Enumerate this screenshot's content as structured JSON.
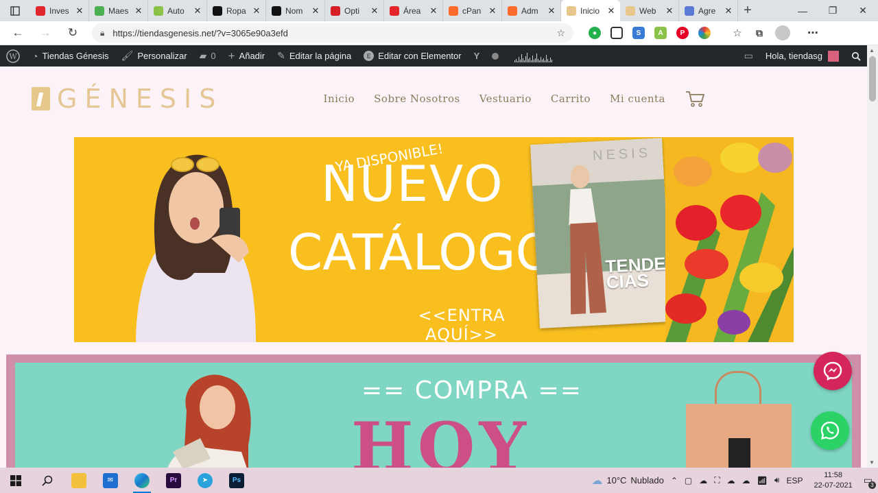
{
  "browser": {
    "tabs": [
      {
        "title": "Inves",
        "icon": "video-play-icon",
        "color": "#e1262c"
      },
      {
        "title": "Maes",
        "icon": "sheet-icon",
        "color": "#4caf50"
      },
      {
        "title": "Auto",
        "icon": "android-icon",
        "color": "#8bc34a"
      },
      {
        "title": "Ropa",
        "icon": "shopify-s-icon",
        "color": "#111111"
      },
      {
        "title": "Nom",
        "icon": "shopify-s-icon",
        "color": "#111111"
      },
      {
        "title": "Opti",
        "icon": "opti-icon",
        "color": "#d81f26"
      },
      {
        "title": "Área",
        "icon": "w-icon",
        "color": "#e5252a"
      },
      {
        "title": "cPan",
        "icon": "cpanel-icon",
        "color": "#ff6c2c"
      },
      {
        "title": "Adm",
        "icon": "cpanel-icon",
        "color": "#ff6c2c"
      },
      {
        "title": "Inicio",
        "icon": "site-favicon-icon",
        "color": "#e8c78c"
      },
      {
        "title": "Web",
        "icon": "site-favicon-icon",
        "color": "#e8c78c"
      },
      {
        "title": "Agre",
        "icon": "page-icon",
        "color": "#5b7bd5"
      }
    ],
    "url": "https://tiendasgenesis.net/?v=3065e90a3efd"
  },
  "adminbar": {
    "site_name": "Tiendas Génesis",
    "customize": "Personalizar",
    "comments_count": "0",
    "add_new": "Añadir",
    "edit_page": "Editar la página",
    "edit_elementor": "Editar con Elementor",
    "greeting": "Hola, tiendasg"
  },
  "site": {
    "logo_text": "GÉNESIS",
    "menu": [
      "Inicio",
      "Sobre Nosotros",
      "Vestuario",
      "Carrito",
      "Mi cuenta"
    ]
  },
  "banner1": {
    "small_text": "YA DISPONIBLE!",
    "title_line1": "NUEVO",
    "title_line2": "CATÁLOGO!!",
    "cta": "<<ENTRA AQUÍ>>",
    "magazine_title": "NESIS",
    "magazine_sub": "TENDEN-\nCIAS"
  },
  "banner2": {
    "line1": "== COMPRA ==",
    "line2": "HOY"
  },
  "taskbar": {
    "temperature": "10°C",
    "weather": "Nublado",
    "language": "ESP",
    "time": "11:58",
    "date": "22-07-2021",
    "notifications": "3"
  },
  "colors": {
    "accent_gold": "#e4c795",
    "banner_yellow": "#f9bf1f",
    "banner_teal": "#7fd6c3",
    "hoy_pink": "#cc4f86",
    "messenger_red": "#d4265a",
    "whatsapp_green": "#2bd366"
  }
}
